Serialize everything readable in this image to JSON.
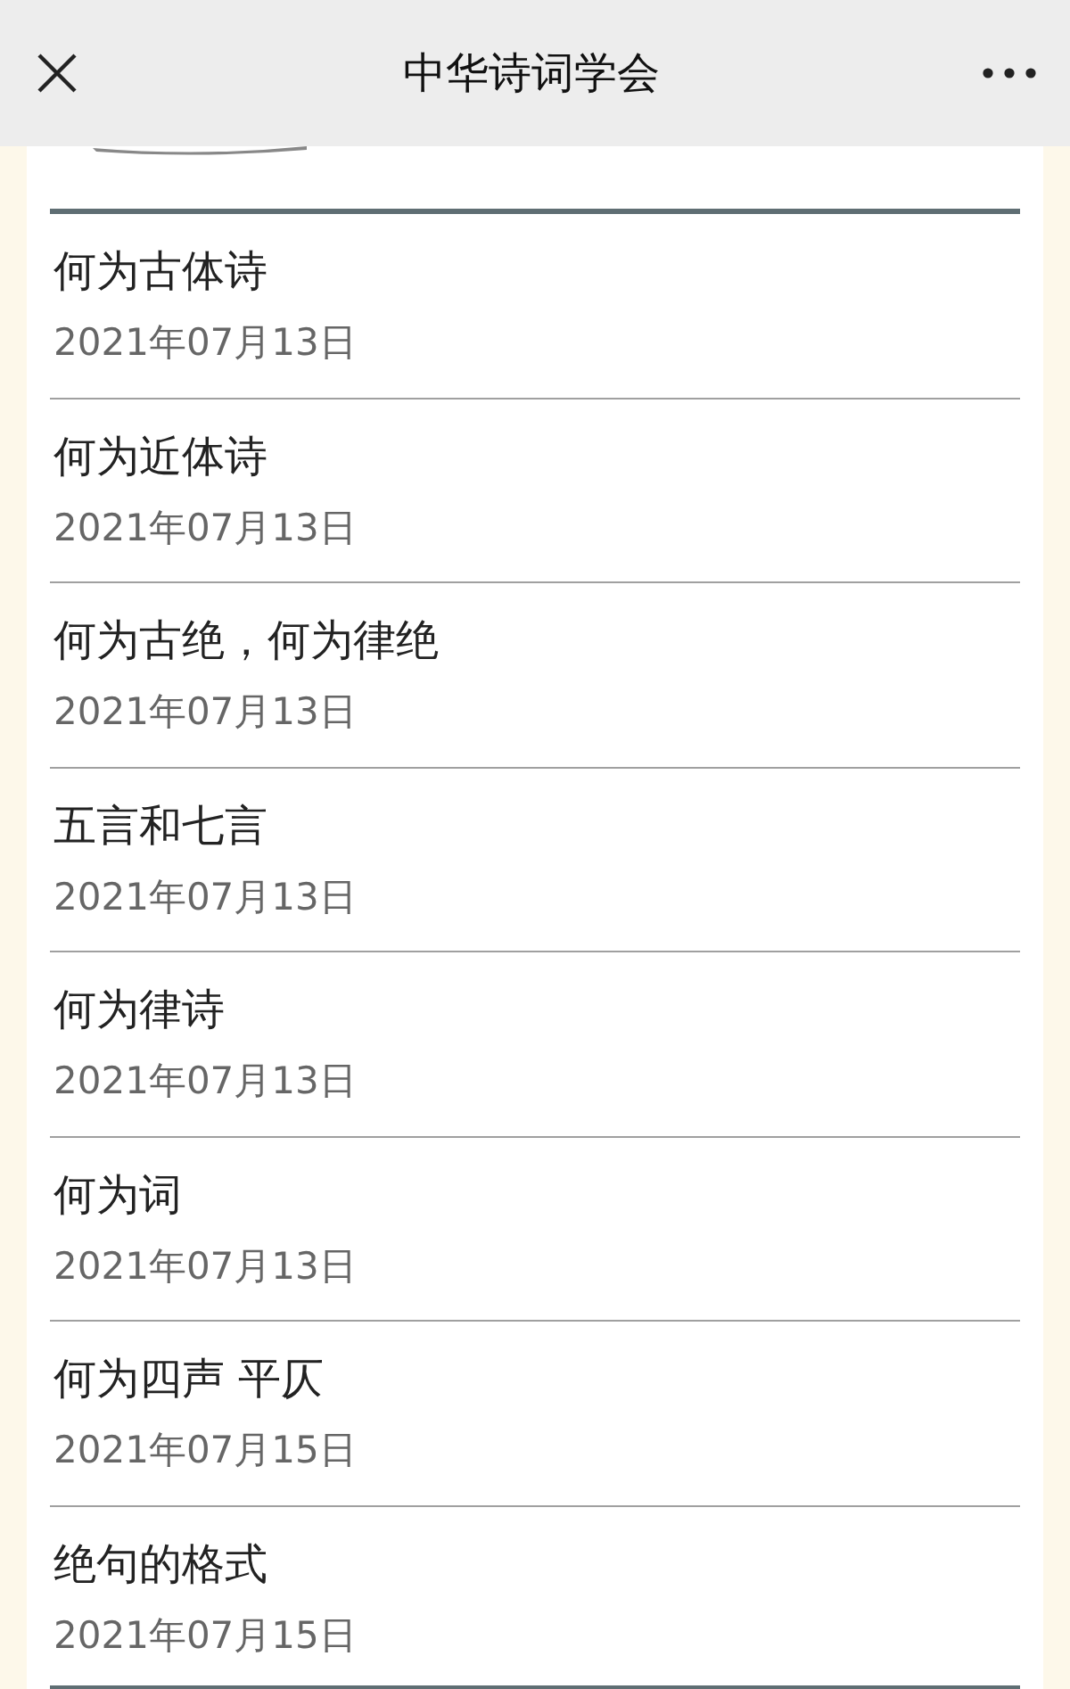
{
  "header": {
    "title": "中华诗词学会"
  },
  "articles": [
    {
      "title": "何为古体诗",
      "date": "2021年07月13日"
    },
    {
      "title": "何为近体诗",
      "date": "2021年07月13日"
    },
    {
      "title": "何为古绝，何为律绝",
      "date": "2021年07月13日"
    },
    {
      "title": "五言和七言",
      "date": "2021年07月13日"
    },
    {
      "title": "何为律诗",
      "date": "2021年07月13日"
    },
    {
      "title": "何为词",
      "date": "2021年07月13日"
    },
    {
      "title": "何为四声 平仄",
      "date": "2021年07月15日"
    },
    {
      "title": "绝句的格式",
      "date": "2021年07月15日"
    }
  ]
}
